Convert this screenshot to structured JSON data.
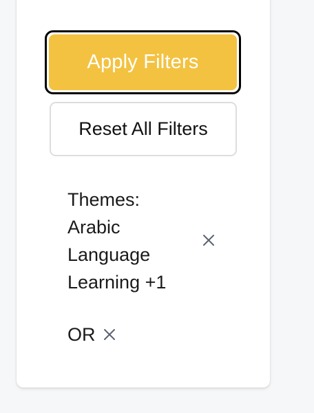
{
  "actions": {
    "apply_label": "Apply Filters",
    "reset_label": "Reset All Filters"
  },
  "active_filters": {
    "theme_chip": {
      "label": "Themes: Arabic Language Learning +1",
      "remove_icon": "close-icon"
    },
    "operator_chip": {
      "label": "OR",
      "remove_icon": "close-icon"
    }
  },
  "colors": {
    "apply_background": "#f3c241",
    "apply_text": "#ffffff",
    "focus_ring": "#000000",
    "reset_border": "#dcdde0",
    "icon": "#5b6270"
  }
}
